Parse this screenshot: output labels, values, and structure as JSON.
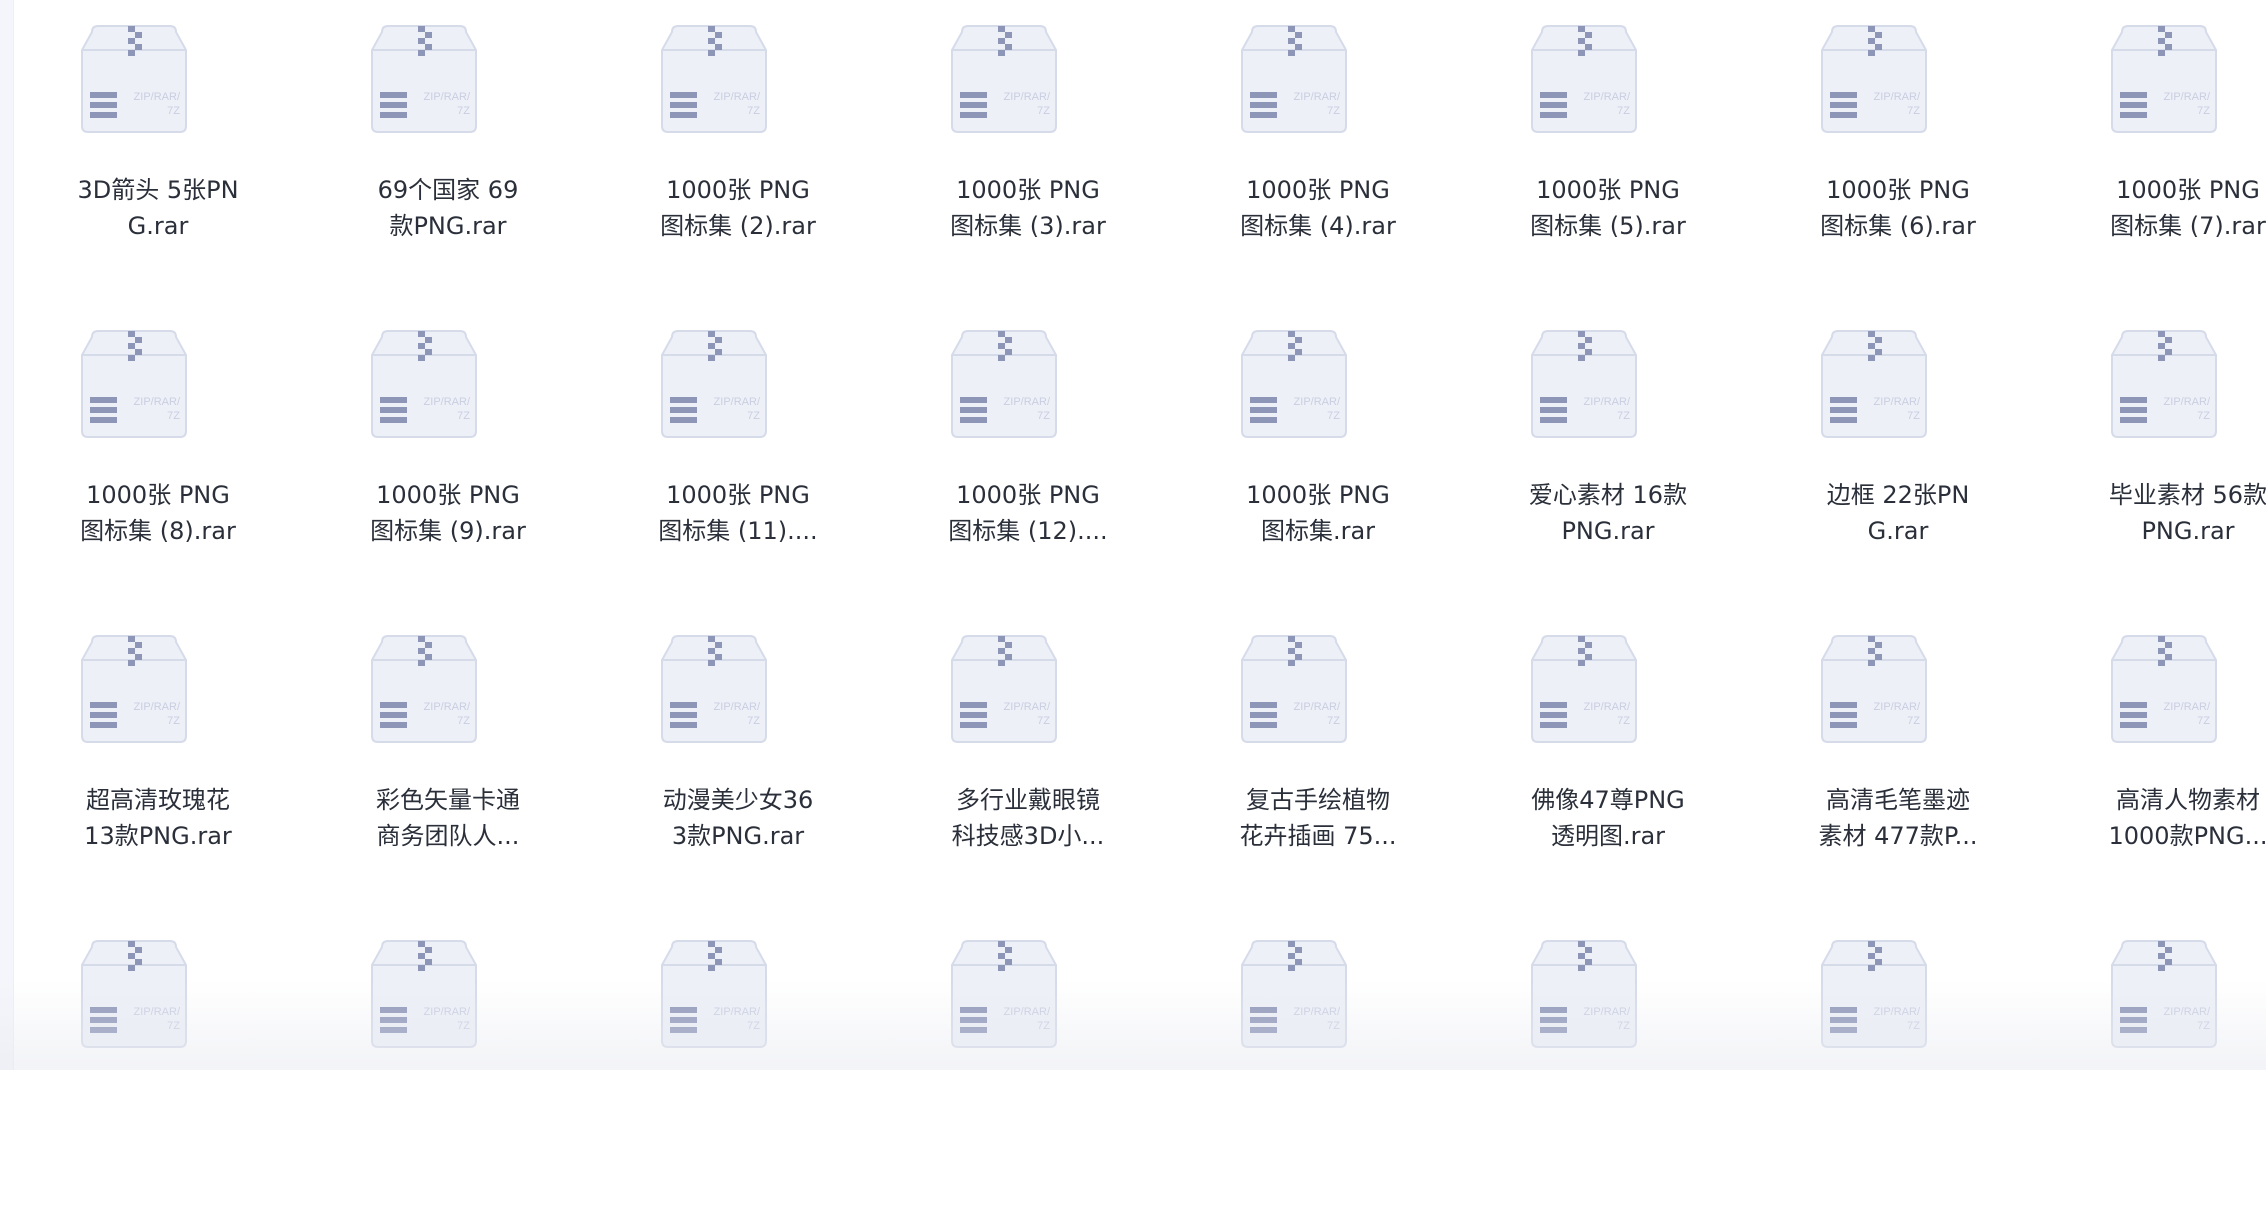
{
  "files": [
    {
      "name": "3D箭头 5张PN\nG.rar",
      "icon": "zip-archive-icon"
    },
    {
      "name": "69个国家 69\n款PNG.rar",
      "icon": "zip-archive-icon"
    },
    {
      "name": "1000张 PNG\n图标集 (2).rar",
      "icon": "zip-archive-icon"
    },
    {
      "name": "1000张 PNG\n图标集 (3).rar",
      "icon": "zip-archive-icon"
    },
    {
      "name": "1000张 PNG\n图标集 (4).rar",
      "icon": "zip-archive-icon"
    },
    {
      "name": "1000张 PNG\n图标集 (5).rar",
      "icon": "zip-archive-icon"
    },
    {
      "name": "1000张 PNG\n图标集 (6).rar",
      "icon": "zip-archive-icon"
    },
    {
      "name": "1000张 PNG\n图标集 (7).rar",
      "icon": "zip-archive-icon"
    },
    {
      "name": "1000张 PNG\n图标集 (8).rar",
      "icon": "zip-archive-icon"
    },
    {
      "name": "1000张 PNG\n图标集 (9).rar",
      "icon": "zip-archive-icon"
    },
    {
      "name": "1000张 PNG\n图标集 (11)....",
      "icon": "zip-archive-icon"
    },
    {
      "name": "1000张 PNG\n图标集 (12)....",
      "icon": "zip-archive-icon"
    },
    {
      "name": "1000张 PNG\n图标集.rar",
      "icon": "zip-archive-icon"
    },
    {
      "name": "爱心素材 16款\nPNG.rar",
      "icon": "zip-archive-icon"
    },
    {
      "name": "边框 22张PN\nG.rar",
      "icon": "zip-archive-icon"
    },
    {
      "name": "毕业素材 56款\nPNG.rar",
      "icon": "zip-archive-icon"
    },
    {
      "name": "超高清玫瑰花\n13款PNG.rar",
      "icon": "zip-archive-icon"
    },
    {
      "name": "彩色矢量卡通\n商务团队人...",
      "icon": "zip-archive-icon"
    },
    {
      "name": "动漫美少女36\n3款PNG.rar",
      "icon": "zip-archive-icon"
    },
    {
      "name": "多行业戴眼镜\n科技感3D小...",
      "icon": "zip-archive-icon"
    },
    {
      "name": "复古手绘植物\n花卉插画 75...",
      "icon": "zip-archive-icon"
    },
    {
      "name": "佛像47尊PNG\n透明图.rar",
      "icon": "zip-archive-icon"
    },
    {
      "name": "高清毛笔墨迹\n素材 477款P...",
      "icon": "zip-archive-icon"
    },
    {
      "name": "高清人物素材\n1000款PNG...",
      "icon": "zip-archive-icon"
    },
    {
      "name": "",
      "icon": "zip-archive-icon"
    },
    {
      "name": "",
      "icon": "zip-archive-icon"
    },
    {
      "name": "",
      "icon": "zip-archive-icon"
    },
    {
      "name": "",
      "icon": "zip-archive-icon"
    },
    {
      "name": "",
      "icon": "zip-archive-icon"
    },
    {
      "name": "",
      "icon": "zip-archive-icon"
    },
    {
      "name": "",
      "icon": "zip-archive-icon"
    },
    {
      "name": "",
      "icon": "zip-archive-icon"
    }
  ],
  "icon_label": "ZIP/RAR/\n7Z",
  "colors": {
    "box_fill": "#eef0f8",
    "box_stroke": "#d6dbea",
    "stripe": "#8e96b8",
    "label_text": "#c9cee0",
    "text": "#2a2f3a"
  }
}
